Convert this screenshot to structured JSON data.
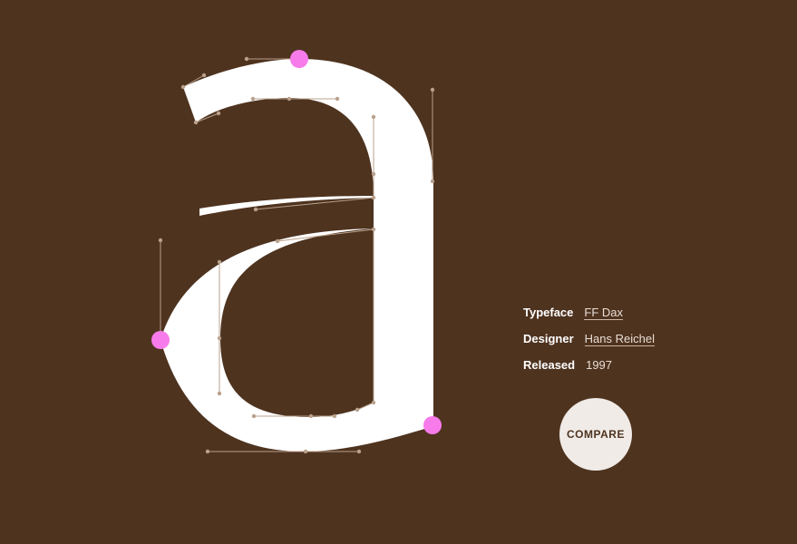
{
  "glyph": {
    "character": "a",
    "fill_color": "#ffffff",
    "handle_color": "#b9a18c",
    "highlight_color": "#f77bea"
  },
  "info": {
    "typeface_label": "Typeface",
    "typeface_value": "FF Dax",
    "designer_label": "Designer",
    "designer_value": "Hans Reichel",
    "released_label": "Released",
    "released_value": "1997"
  },
  "compare_button": {
    "label": "COMPARE"
  },
  "colors": {
    "background": "#4e331f",
    "text": "#ffffff",
    "link": "#e9ddd3",
    "button_bg": "#f0ebe7"
  }
}
